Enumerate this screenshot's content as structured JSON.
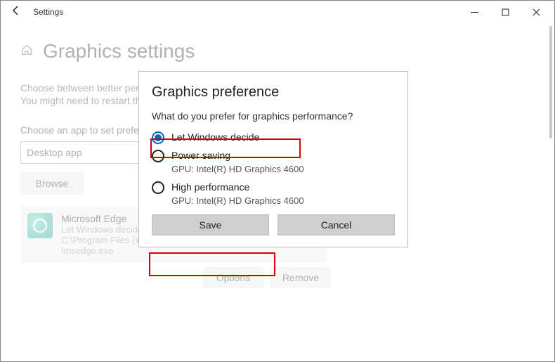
{
  "titlebar": {
    "title": "Settings"
  },
  "page": {
    "title": "Graphics settings",
    "desc1": "Choose between better performance or longer battery life when using an app.",
    "desc2": "You might need to restart the app for your changes to take effect.",
    "section_label": "Choose an app to set preference",
    "dropdown_value": "Desktop app",
    "browse_label": "Browse"
  },
  "app": {
    "name": "Microsoft Edge",
    "pref": "Let Windows decide",
    "path1": "C:\\Program Files (x86)\\Microsoft\\Edge\\Application",
    "path2": "\\msedge.exe",
    "options_label": "Options",
    "remove_label": "Remove"
  },
  "dialog": {
    "title": "Graphics preference",
    "question": "What do you prefer for graphics performance?",
    "option1": "Let Windows decide",
    "option2": "Power saving",
    "option2_sub": "GPU: Intel(R) HD Graphics 4600",
    "option3": "High performance",
    "option3_sub": "GPU: Intel(R) HD Graphics 4600",
    "save_label": "Save",
    "cancel_label": "Cancel"
  }
}
